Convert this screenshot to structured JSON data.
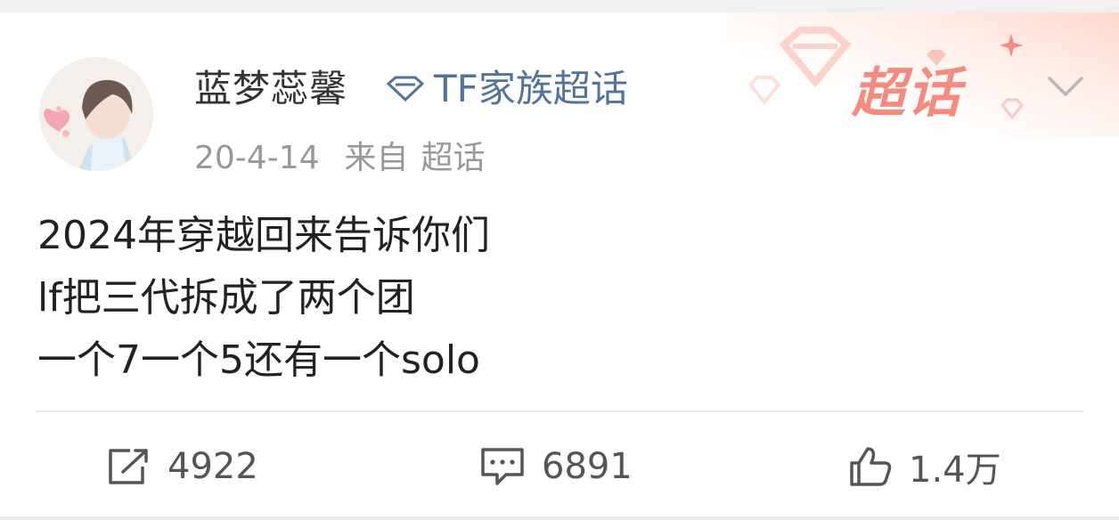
{
  "post": {
    "username": "蓝梦蕊馨",
    "topic": "TF家族超话",
    "date": "20-4-14",
    "source_prefix": "来自",
    "source_name": "超话",
    "badge_label": "超话",
    "content_lines": [
      "2024年穿越回来告诉你们",
      "lf把三代拆成了两个团",
      "一个7一个5还有一个solo"
    ]
  },
  "actions": {
    "repost_count": "4922",
    "comment_count": "6891",
    "like_count": "1.4万"
  },
  "colors": {
    "topic": "#53739a",
    "badge": "#f58a7e",
    "meta": "#999999"
  },
  "icons": [
    "diamond-icon",
    "sparkle-icon",
    "chevron-down-icon",
    "repost-icon",
    "comment-icon",
    "like-icon"
  ]
}
